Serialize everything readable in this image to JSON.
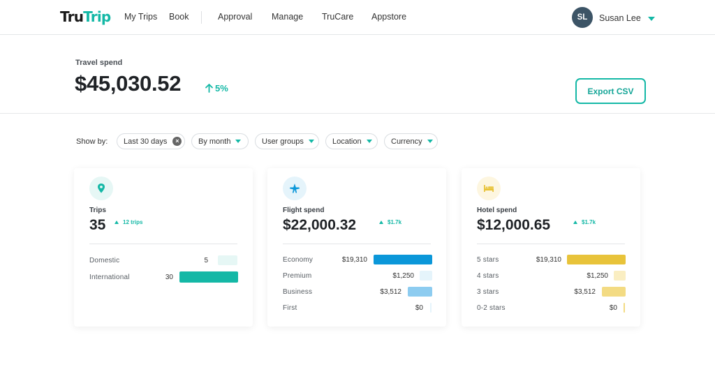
{
  "nav": {
    "logo_primary": "Tru",
    "logo_accent": "Trip",
    "items": [
      "My Trips",
      "Book",
      "Approval",
      "Manage",
      "TruCare",
      "Appstore"
    ],
    "user": {
      "initials": "SL",
      "name": "Susan Lee",
      "avatar_color": "#3c5466"
    }
  },
  "summary": {
    "label": "Travel spend",
    "amount": "$45,030.52",
    "change": "5%",
    "change_direction": "up",
    "export_label": "Export CSV"
  },
  "filters": {
    "label": "Show by:",
    "chips": [
      {
        "label": "Last 30 days",
        "control": "clear"
      },
      {
        "label": "By month",
        "control": "dropdown"
      },
      {
        "label": "User groups",
        "control": "dropdown"
      },
      {
        "label": "Location",
        "control": "dropdown"
      },
      {
        "label": "Currency",
        "control": "dropdown"
      }
    ]
  },
  "colors": {
    "accent": "#14b8a6",
    "trips_bar": "#14b8a6",
    "flight_bar": "#0b97d9",
    "hotel_bar": "#e8c33a"
  },
  "cards": [
    {
      "icon": "map-pin-icon",
      "title": "Trips",
      "value": "35",
      "badge": "12 trips",
      "rows": [
        {
          "label": "Domestic",
          "value": "5",
          "fraction": 0.14
        },
        {
          "label": "International",
          "value": "30",
          "fraction": 1.0
        }
      ]
    },
    {
      "icon": "airplane-icon",
      "title": "Flight spend",
      "value": "$22,000.32",
      "badge": "$1.7k",
      "rows": [
        {
          "label": "Economy",
          "value": "$19,310",
          "fraction": 1.0
        },
        {
          "label": "Premium",
          "value": "$1,250",
          "fraction": 0.065
        },
        {
          "label": "Business",
          "value": "$3,512",
          "fraction": 0.18
        },
        {
          "label": "First",
          "value": "$0",
          "fraction": 0.0
        }
      ]
    },
    {
      "icon": "bed-icon",
      "title": "Hotel spend",
      "value": "$12,000.65",
      "badge": "$1.7k",
      "rows": [
        {
          "label": "5 stars",
          "value": "$19,310",
          "fraction": 1.0
        },
        {
          "label": "4 stars",
          "value": "$1,250",
          "fraction": 0.065
        },
        {
          "label": "3 stars",
          "value": "$3,512",
          "fraction": 0.18
        },
        {
          "label": "0-2 stars",
          "value": "$0",
          "fraction": 0.0
        }
      ]
    }
  ]
}
